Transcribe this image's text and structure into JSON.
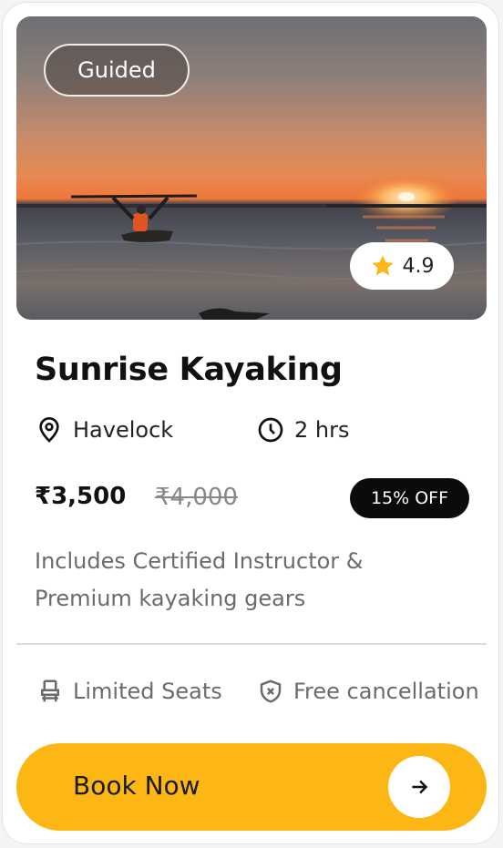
{
  "card": {
    "tag": "Guided",
    "rating": "4.9",
    "title": "Sunrise Kayaking",
    "location": "Havelock",
    "duration": "2 hrs",
    "price": "₹3,500",
    "original_price": "₹4,000",
    "discount": "15% OFF",
    "description": "Includes Certified Instructor & Premium kayaking gears",
    "features": {
      "seats": "Limited Seats",
      "cancellation": "Free cancellation"
    },
    "cta": "Book Now"
  },
  "colors": {
    "accent": "#fdb714",
    "discount_bg": "#0b0b0b",
    "star": "#fdb714"
  },
  "icons": {
    "location": "location-pin-icon",
    "duration": "clock-icon",
    "rating": "star-icon",
    "seats": "seat-icon",
    "cancellation": "shield-x-icon",
    "cta": "arrow-right-icon"
  }
}
